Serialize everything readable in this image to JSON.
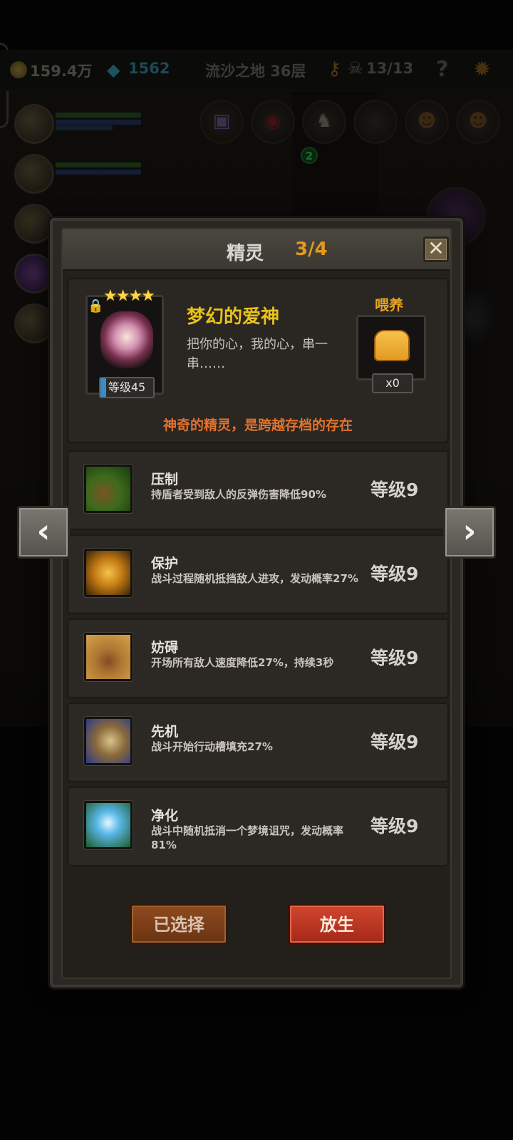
{
  "topbar": {
    "gold": "159.4万",
    "gems": "1562",
    "location": "流沙之地 36层",
    "kills": "13/13",
    "help": "?"
  },
  "background_slots": {
    "badge": "2"
  },
  "modal": {
    "title": "精灵",
    "count": "3/4",
    "close": "✕",
    "pet": {
      "stars": "★★★★",
      "level": "等级45",
      "name": "梦幻的爱神",
      "description": "把你的心，我的心，串一串……",
      "feed_label": "喂养",
      "feed_count": "x0",
      "note": "神奇的精灵，是跨越存档的存在"
    },
    "skills": [
      {
        "name": "压制",
        "desc": "持盾者受到敌人的反弹伤害降低90%",
        "level": "等级9",
        "icon": "grass-claw-icon"
      },
      {
        "name": "保护",
        "desc": "战斗过程随机抵挡敌人进攻，发动概率27%",
        "level": "等级9",
        "icon": "golden-fairy-icon"
      },
      {
        "name": "妨碍",
        "desc": "开场所有敌人速度降低27%，持续3秒",
        "level": "等级9",
        "icon": "chained-boot-icon"
      },
      {
        "name": "先机",
        "desc": "战斗开始行动槽填充27%",
        "level": "等级9",
        "icon": "leopard-icon"
      },
      {
        "name": "净化",
        "desc": "战斗中随机抵消一个梦境诅咒，发动概率81%",
        "level": "等级9",
        "icon": "blue-flower-icon"
      }
    ],
    "buttons": {
      "selected": "已选择",
      "release": "放生"
    }
  },
  "nav": {
    "prev": "‹",
    "next": "›"
  },
  "colors": {
    "accent_orange": "#e29a1f",
    "name_yellow": "#e8c21c",
    "note_orange": "#e0722e",
    "release_red": "#c23a24"
  }
}
